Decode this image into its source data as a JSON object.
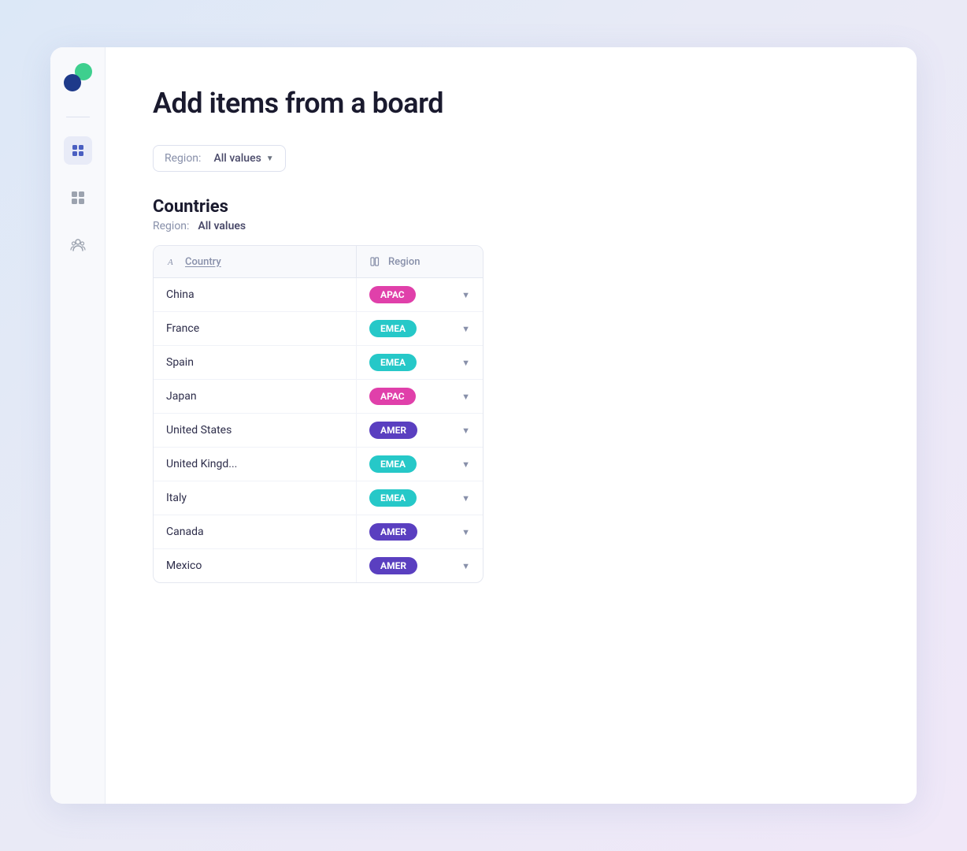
{
  "page": {
    "title": "Add items from a board"
  },
  "sidebar": {
    "icons": [
      {
        "name": "logo",
        "type": "logo"
      },
      {
        "name": "divider",
        "type": "divider"
      },
      {
        "name": "board-icon",
        "label": "Board",
        "active": true,
        "shape": "square"
      },
      {
        "name": "apps-icon",
        "label": "Apps",
        "active": false,
        "shape": "grid"
      },
      {
        "name": "team-icon",
        "label": "Team",
        "active": false,
        "shape": "team"
      }
    ]
  },
  "filter": {
    "label": "Region:",
    "value": "All values",
    "dropdown_aria": "Filter by region"
  },
  "board": {
    "title": "Countries",
    "subtitle_label": "Region:",
    "subtitle_value": "All values",
    "columns": [
      {
        "key": "country",
        "label": "Country",
        "icon": "text-icon"
      },
      {
        "key": "region",
        "label": "Region",
        "icon": "column-icon"
      }
    ],
    "rows": [
      {
        "country": "China",
        "region": "APAC",
        "badge_class": "badge-apac-pink"
      },
      {
        "country": "France",
        "region": "EMEA",
        "badge_class": "badge-emea-teal"
      },
      {
        "country": "Spain",
        "region": "EMEA",
        "badge_class": "badge-emea-teal"
      },
      {
        "country": "Japan",
        "region": "APAC",
        "badge_class": "badge-apac-pink"
      },
      {
        "country": "United States",
        "region": "AMER",
        "badge_class": "badge-amer"
      },
      {
        "country": "United Kingd...",
        "region": "EMEA",
        "badge_class": "badge-emea-teal"
      },
      {
        "country": "Italy",
        "region": "EMEA",
        "badge_class": "badge-emea-teal"
      },
      {
        "country": "Canada",
        "region": "AMER",
        "badge_class": "badge-amer"
      },
      {
        "country": "Mexico",
        "region": "AMER",
        "badge_class": "badge-amer"
      }
    ]
  }
}
